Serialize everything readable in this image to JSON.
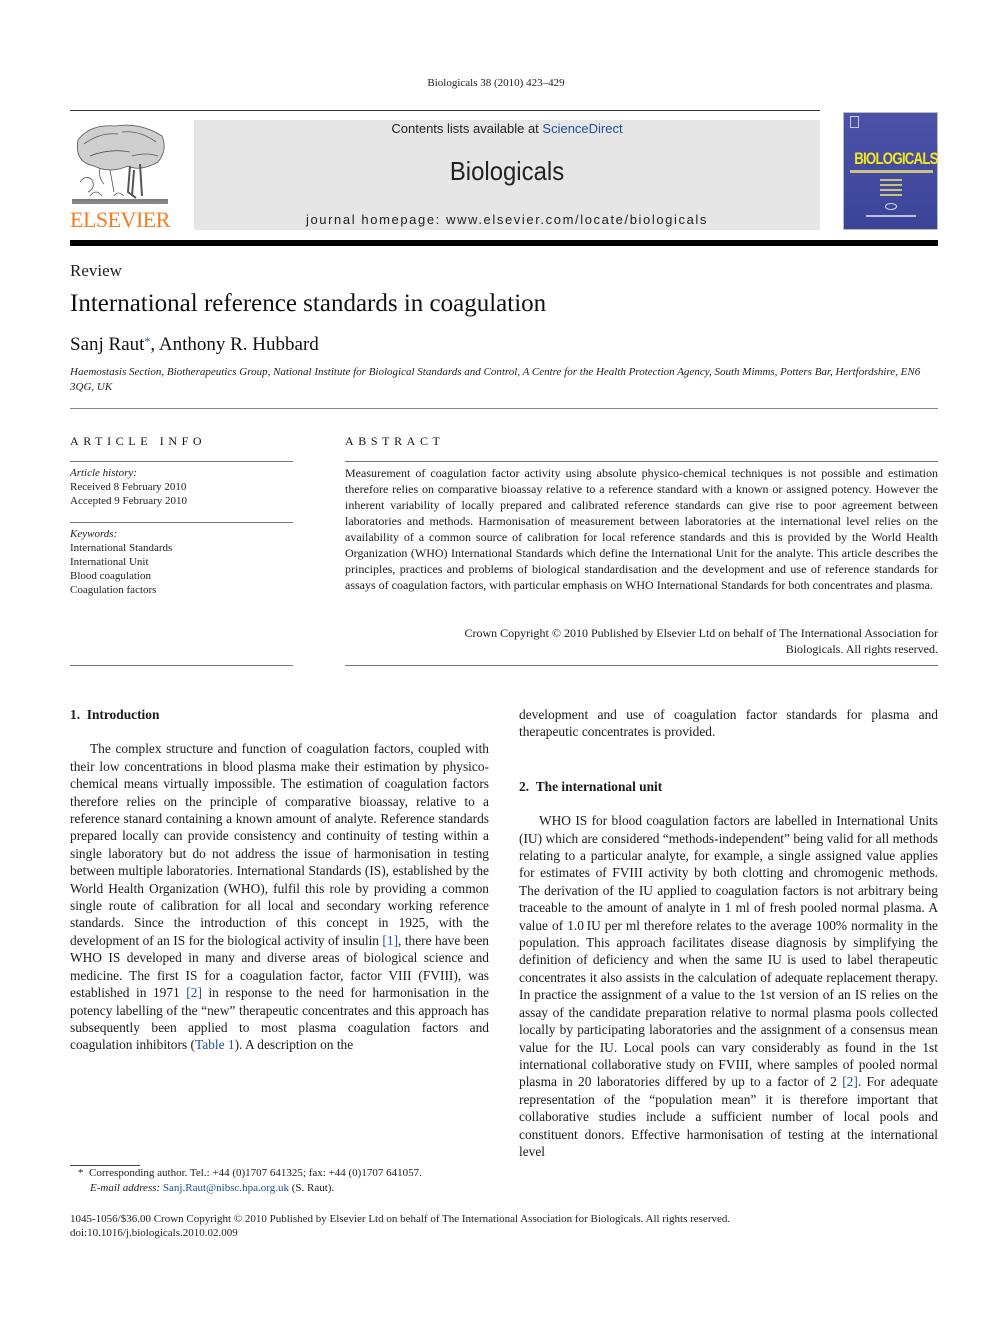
{
  "header": {
    "journal_ref": "Biologicals 38 (2010) 423–429",
    "publisher_logo_text": "ELSEVIER",
    "contents_prefix": "Contents lists available at ",
    "contents_link": "ScienceDirect",
    "journal_name": "Biologicals",
    "homepage": "journal homepage: www.elsevier.com/locate/biologicals",
    "cover_title": "BIOLOGICALS",
    "brand_color": "#f47c20",
    "link_color": "#1f4e9b"
  },
  "article": {
    "type": "Review",
    "title": "International reference standards in coagulation",
    "authors": [
      {
        "name": "Sanj Raut",
        "marker": "*"
      },
      {
        "name": "Anthony R. Hubbard",
        "marker": ""
      }
    ],
    "author_separator": ", ",
    "affiliation": "Haemostasis Section, Biotherapeutics Group, National Institute for Biological Standards and Control, A Centre for the Health Protection Agency, South Mimms, Potters Bar, Hertfordshire, EN6 3QG, UK"
  },
  "article_info": {
    "heading": "ARTICLE INFO",
    "history_label": "Article history:",
    "history": [
      "Received 8 February 2010",
      "Accepted 9 February 2010"
    ],
    "keywords_label": "Keywords:",
    "keywords": [
      "International Standards",
      "International Unit",
      "Blood coagulation",
      "Coagulation factors"
    ]
  },
  "abstract": {
    "heading": "ABSTRACT",
    "text": "Measurement of coagulation factor activity using absolute physico-chemical techniques is not possible and estimation therefore relies on comparative bioassay relative to a reference standard with a known or assigned potency. However the inherent variability of locally prepared and calibrated reference standards can give rise to poor agreement between laboratories and methods. Harmonisation of measurement between laboratories at the international level relies on the availability of a common source of calibration for local reference standards and this is provided by the World Health Organization (WHO) International Standards which define the International Unit for the analyte. This article describes the principles, practices and problems of biological standardisation and the development and use of reference standards for assays of coagulation factors, with particular emphasis on WHO International Standards for both concentrates and plasma.",
    "copyright_line1": "Crown Copyright © 2010 Published by Elsevier Ltd on behalf of The International Association for",
    "copyright_line2": "Biologicals. All rights reserved."
  },
  "sections": {
    "intro": {
      "heading": "1. Introduction",
      "p1": "The complex structure and function of coagulation factors, coupled with their low concentrations in blood plasma make their estimation by physico-chemical means virtually impossible. The estimation of coagulation factors therefore relies on the principle of comparative bioassay, relative to a reference stan­ard containing a known amount of analyte. Reference standards prepared locally can provide consistency and continuity of testing within a single laboratory but do not address the issue of harmonisation in testing between multiple laboratories. Inter­national Standards (IS), established by the World Health Orga­nization (WHO), fulfil this role by providing a common single route of calibration for all local and secondary working reference standards. Since the introduction of this concept in 1925, with the development of an IS for the biological activity of insulin ",
      "ref1": "[1]",
      "p2": ", there have been WHO IS developed in many and diverse areas of biological science and medicine. The first IS for a coagulation factor, factor VIII (FVIII), was established in 1971 ",
      "ref2": "[2]",
      "p3": " in response to the need for harmonisation in the potency labelling of the “new” therapeutic concentrates and this approach has subse­quently been applied to most plasma coagulation factors and coagulation inhibitors (",
      "table_ref": "Table 1",
      "p4": "). A description on the",
      "continued": "development and use of coagulation factor standards for plasma and therapeutic concentrates is provided."
    },
    "iu": {
      "heading": "2. The international unit",
      "p1": "WHO IS for blood coagulation factors are labelled in Interna­tional Units (IU) which are considered “methods-independent” being valid for all methods relating to a particular analyte, for example, a single assigned value applies for estimates of FVIII activity by both clotting and chromogenic methods. The derivation of the IU applied to coagulation factors is not arbitrary being traceable to the amount of analyte in 1 ml of fresh pooled normal plasma. A value of 1.0 IU per ml therefore relates to the average 100% normality in the population. This approach facilitates disease diagnosis by simplifying the definition of deficiency and when the same IU is used to label therapeutic concentrates it also assists in the calculation of adequate replacement therapy. In practice the assignment of a value to the 1st version of an IS relies on the assay of the candidate preparation relative to normal plasma pools collected locally by participating laboratories and the assignment of a consensus mean value for the IU. Local pools can vary consider­ably as found in the 1st international collaborative study on FVIII, where samples of pooled normal plasma in 20 laboratories differed by up to a factor of 2 ",
      "ref2": "[2]",
      "p2": ". For adequate representation of the “population mean” it is therefore important that collaborative studies include a sufficient number of local pools and constituent donors. Effective harmonisation of testing at the international level"
    }
  },
  "footnote": {
    "marker": "*",
    "corresponding": "Corresponding author. Tel.: +44 (0)1707 641325; fax: +44 (0)1707 641057.",
    "email_label": "E-mail address:",
    "email": "Sanj.Raut@nibsc.hpa.org.uk",
    "email_suffix": " (S. Raut)."
  },
  "bottom": {
    "issn_line": "1045-1056/$36.00 Crown Copyright © 2010 Published by Elsevier Ltd on behalf of The International Association for Biologicals. All rights reserved.",
    "doi": "doi:10.1016/j.biologicals.2010.02.009"
  }
}
